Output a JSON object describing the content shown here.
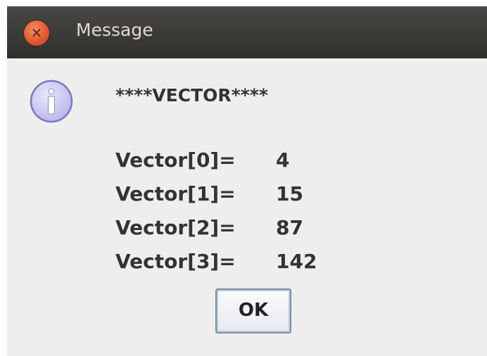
{
  "window": {
    "title": "Message",
    "close_glyph": "×"
  },
  "message": {
    "icon": "info-icon",
    "header": "****VECTOR****",
    "rows": [
      {
        "label": "Vector[0]=",
        "value": "4"
      },
      {
        "label": "Vector[1]=",
        "value": "15"
      },
      {
        "label": "Vector[2]=",
        "value": "87"
      },
      {
        "label": "Vector[3]=",
        "value": "142"
      }
    ]
  },
  "buttons": {
    "ok_label": "OK"
  },
  "colors": {
    "titlebar": "#3a3935",
    "close_button": "#e0552b",
    "dialog_background": "#eeeeee",
    "text": "#333333",
    "info_icon_fill": "#c9c9f2"
  }
}
